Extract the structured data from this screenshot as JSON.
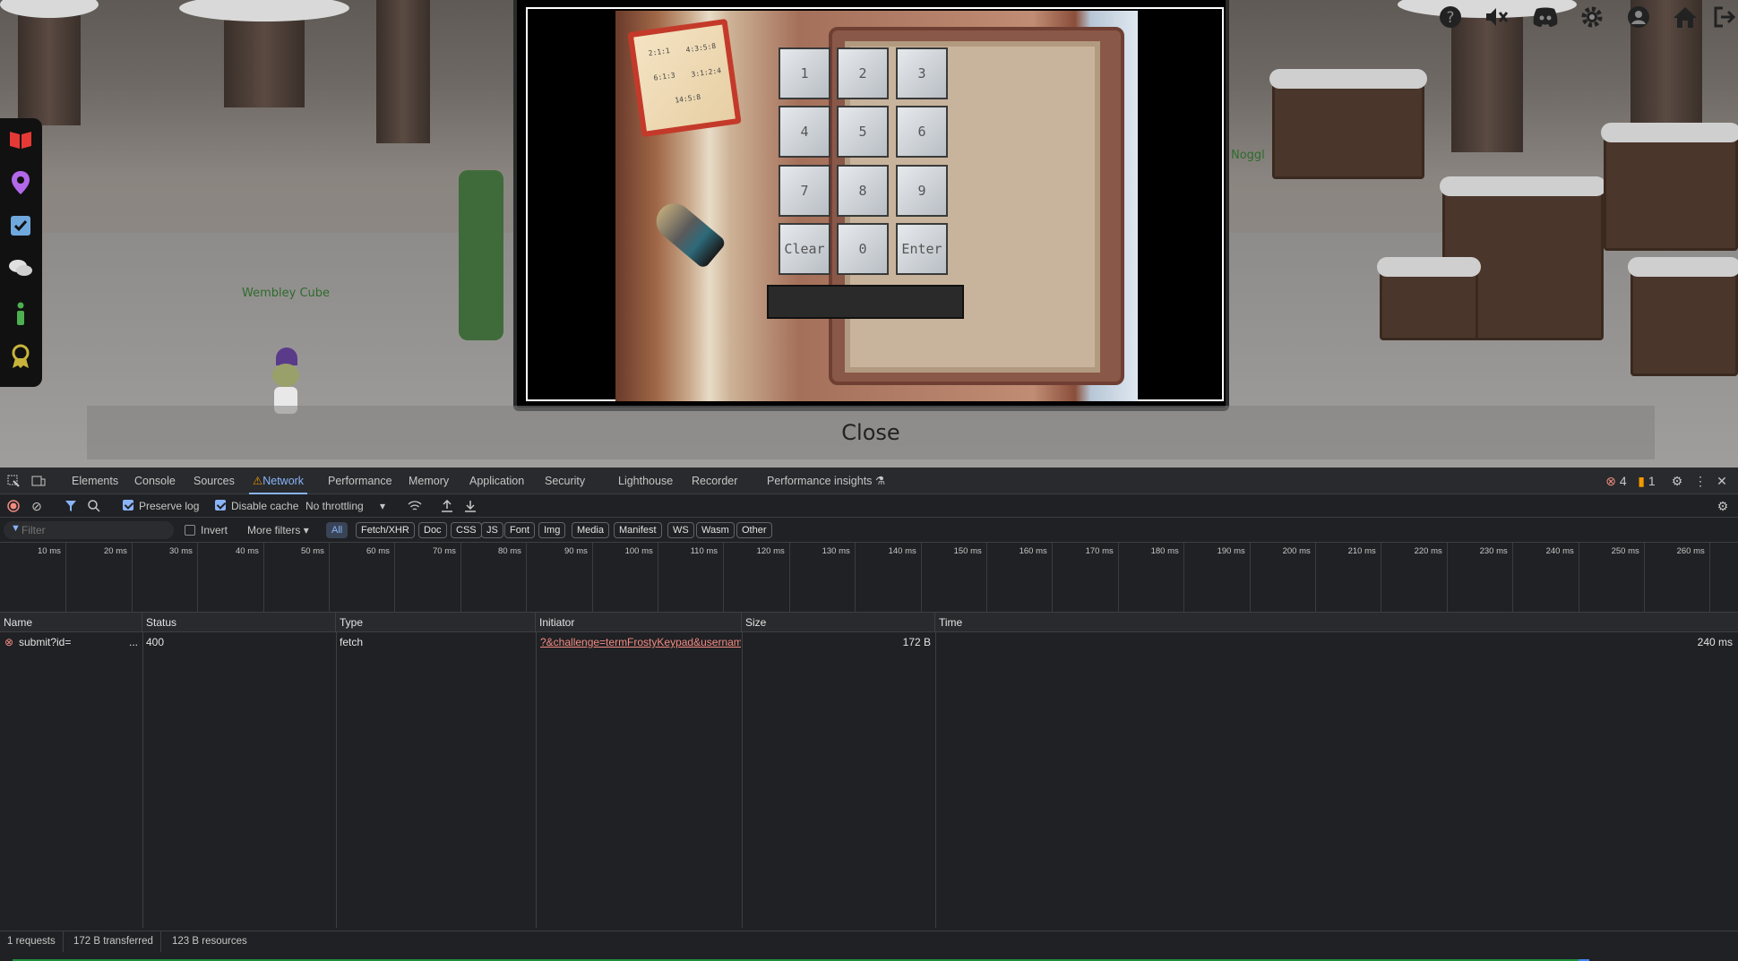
{
  "game": {
    "npc_labels": [
      "Wembley Cube",
      "Noggl"
    ],
    "left_toolbar_icons": [
      "book-icon",
      "location-pin-icon",
      "checklist-icon",
      "chat-icon",
      "info-icon",
      "badge-icon"
    ],
    "top_right_icons": [
      "help-icon",
      "mute-icon",
      "discord-icon",
      "settings-icon",
      "account-icon",
      "home-icon",
      "logout-icon"
    ],
    "keypad": {
      "keys": [
        "1",
        "2",
        "3",
        "4",
        "5",
        "6",
        "7",
        "8",
        "9",
        "Clear",
        "0",
        "Enter"
      ],
      "display_value": "",
      "note_lines": [
        "2:1:1",
        "4:3:5:8",
        "6:1:3",
        "3:1:2:4",
        "14:5:8"
      ]
    },
    "close_label": "Close"
  },
  "devtools": {
    "tabs": [
      "Elements",
      "Console",
      "Sources",
      "Network",
      "Performance",
      "Memory",
      "Application",
      "Security",
      "Lighthouse",
      "Recorder",
      "Performance insights"
    ],
    "active_tab": "Network",
    "error_count": "4",
    "issue_count": "1",
    "toolbar": {
      "preserve_log_label": "Preserve log",
      "preserve_log_checked": true,
      "disable_cache_label": "Disable cache",
      "disable_cache_checked": true,
      "throttling_value": "No throttling"
    },
    "filterbar": {
      "filter_placeholder": "Filter",
      "invert_label": "Invert",
      "more_filters_label": "More filters",
      "type_filters": [
        "All",
        "Fetch/XHR",
        "Doc",
        "CSS",
        "JS",
        "Font",
        "Img",
        "Media",
        "Manifest",
        "WS",
        "Wasm",
        "Other"
      ],
      "active_filter": "All"
    },
    "timeline_ticks": [
      "10 ms",
      "20 ms",
      "30 ms",
      "40 ms",
      "50 ms",
      "60 ms",
      "70 ms",
      "80 ms",
      "90 ms",
      "100 ms",
      "110 ms",
      "120 ms",
      "130 ms",
      "140 ms",
      "150 ms",
      "160 ms",
      "170 ms",
      "180 ms",
      "190 ms",
      "200 ms",
      "210 ms",
      "220 ms",
      "230 ms",
      "240 ms",
      "250 ms",
      "260 ms"
    ],
    "columns": [
      "Name",
      "Status",
      "Type",
      "Initiator",
      "Size",
      "Time"
    ],
    "rows": [
      {
        "name": "submit?id=",
        "name_more": "...",
        "status": "400",
        "type": "fetch",
        "initiator": "?&challenge=termFrostyKeypad&usernam",
        "size": "172 B",
        "time": "240 ms"
      }
    ],
    "status_bar": [
      "1 requests",
      "172 B transferred",
      "123 B resources"
    ]
  }
}
